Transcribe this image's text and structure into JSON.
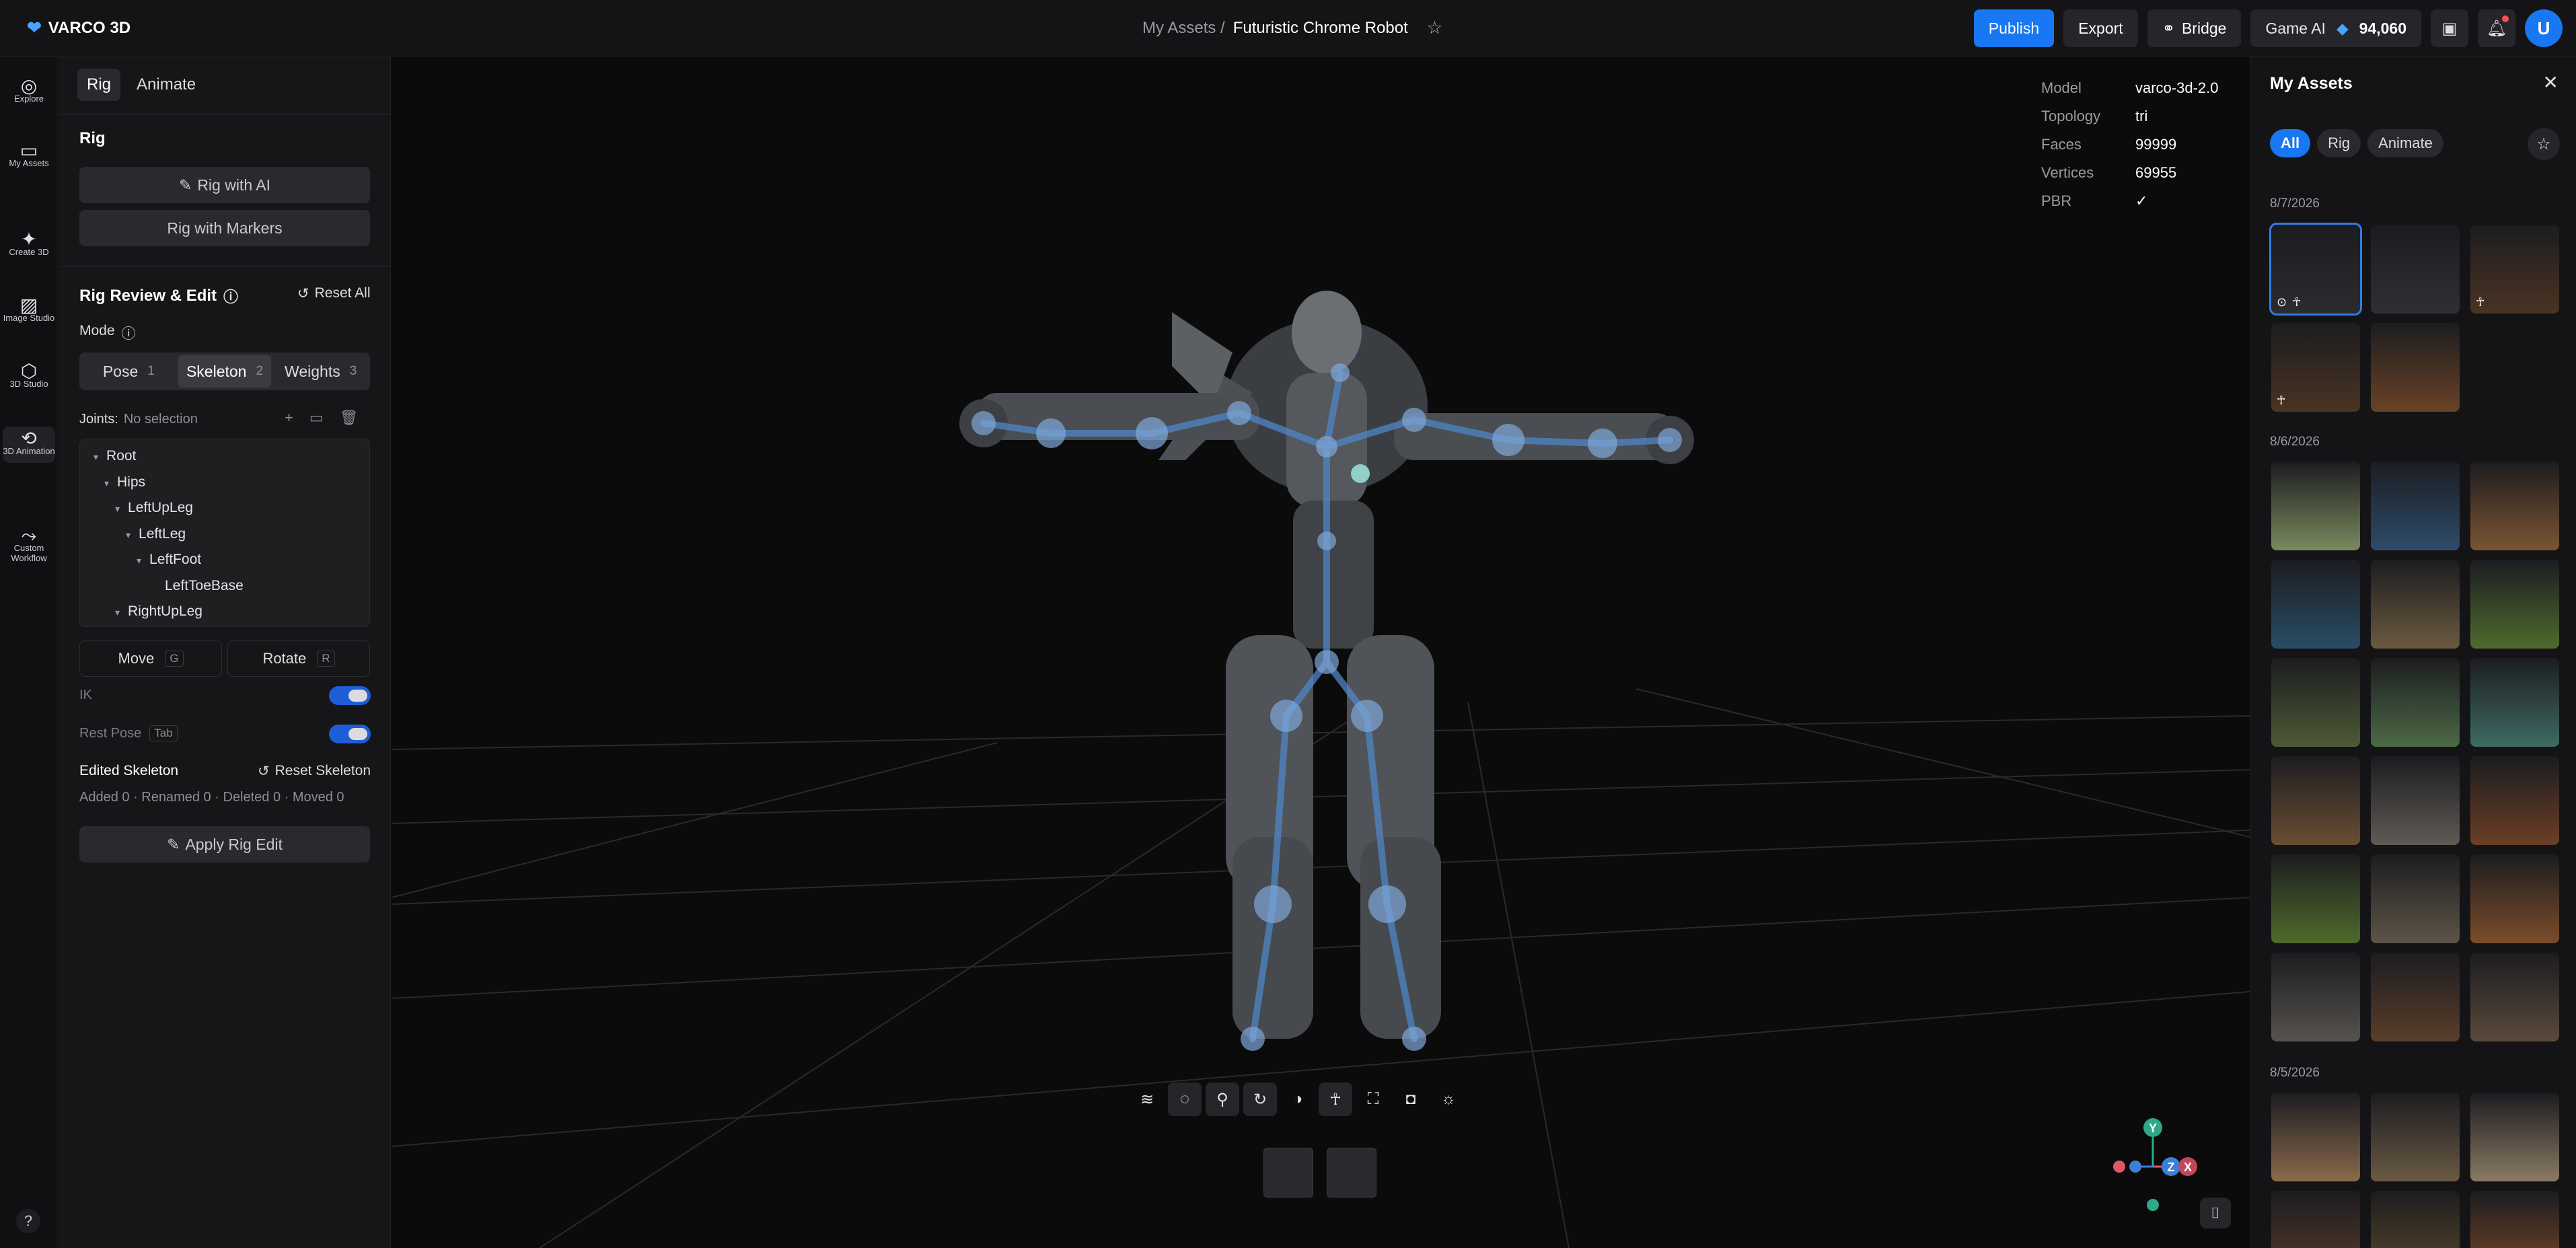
{
  "topbar": {
    "brand": "VARCO 3D",
    "breadcrumb_parent": "My Assets /",
    "breadcrumb_current": "Futuristic Chrome Robot",
    "publish": "Publish",
    "export": "Export",
    "bridge": "Bridge",
    "game_ai": "Game AI",
    "credits": "94,060",
    "avatar": "U"
  },
  "leftnav": {
    "explore": "Explore",
    "my_assets": "My Assets",
    "create_3d": "Create 3D",
    "image_studio": "Image Studio",
    "studio_3d": "3D Studio",
    "animation_3d": "3D Animation",
    "custom_workflow": "Custom Workflow",
    "help": "?"
  },
  "panel": {
    "tab_rig": "Rig",
    "tab_animate": "Animate",
    "rig_heading": "Rig",
    "rig_ai": "Rig with AI",
    "rig_markers": "Rig with Markers",
    "review_heading": "Rig Review & Edit",
    "reset_all": "Reset All",
    "mode_label": "Mode",
    "modes": [
      {
        "label": "Pose",
        "num": "1"
      },
      {
        "label": "Skeleton",
        "num": "2"
      },
      {
        "label": "Weights",
        "num": "3"
      }
    ],
    "joints_label": "Joints:",
    "joints_value": "No selection",
    "tree": [
      "Root",
      "Hips",
      "LeftUpLeg",
      "LeftLeg",
      "LeftFoot",
      "LeftToeBase",
      "RightUpLeg"
    ],
    "move": "Move",
    "move_key": "G",
    "rotate": "Rotate",
    "rotate_key": "R",
    "ik": "IK",
    "rest_pose": "Rest Pose",
    "rest_key": "Tab",
    "edited_skeleton": "Edited Skeleton",
    "reset_skeleton": "Reset Skeleton",
    "stats": "Added 0 · Renamed 0 · Deleted 0 · Moved 0",
    "apply": "Apply Rig Edit"
  },
  "model_info": {
    "model_k": "Model",
    "model_v": "varco-3d-2.0",
    "topology_k": "Topology",
    "topology_v": "tri",
    "faces_k": "Faces",
    "faces_v": "99999",
    "vertices_k": "Vertices",
    "vertices_v": "69955",
    "pbr_k": "PBR",
    "pbr_v": "✓"
  },
  "gizmo": {
    "y": "Y",
    "z": "Z",
    "x": "X"
  },
  "assets": {
    "title": "My Assets",
    "chips": [
      "All",
      "Rig",
      "Animate"
    ],
    "dates": [
      "8/7/2026",
      "8/6/2026",
      "8/5/2026"
    ]
  },
  "colors": {
    "accent": "#1877f2",
    "bone": "#4f86c6"
  }
}
